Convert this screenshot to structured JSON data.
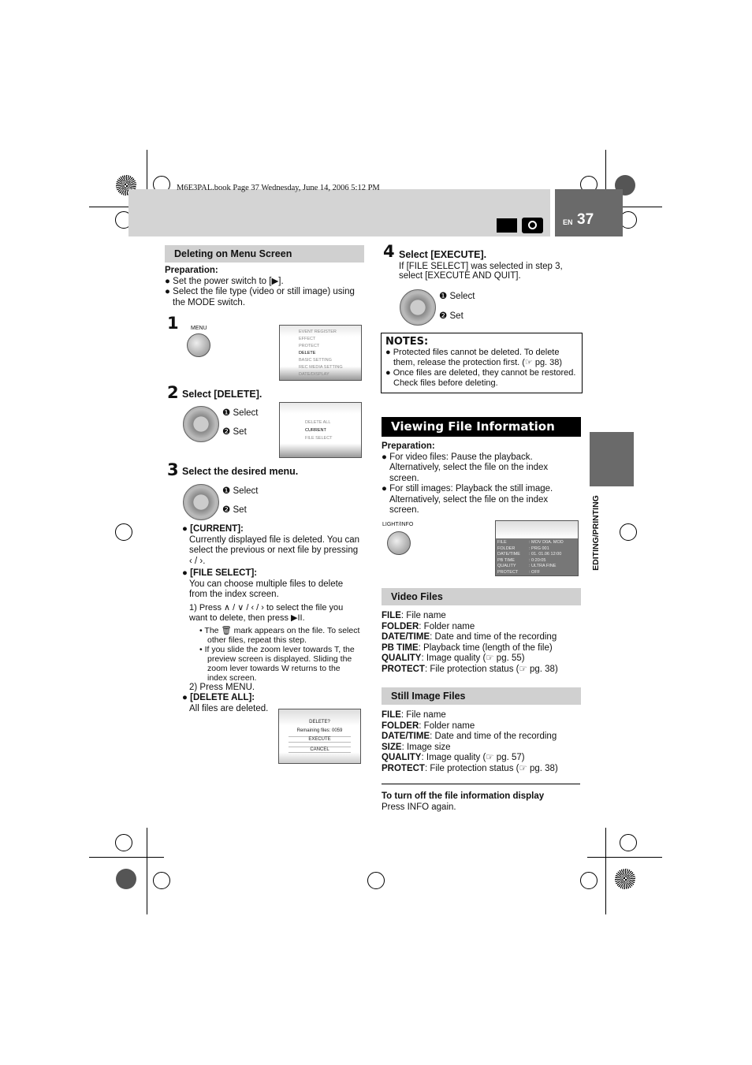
{
  "header": {
    "book_line": "M6E3PAL.book  Page 37  Wednesday, June 14, 2006  5:12 PM",
    "lang": "EN",
    "page_number": "37",
    "mode_icons": [
      "video-camera-icon",
      "still-camera-icon"
    ]
  },
  "side_tab": {
    "label": "EDITING/PRINTING"
  },
  "left": {
    "section_title": "Deleting on Menu Screen",
    "prep_label": "Preparation:",
    "prep_items": [
      "Set the power switch to [▶].",
      "Select the file type (video or still image) using the MODE switch."
    ],
    "step1": {
      "num": "1",
      "button_label": "MENU",
      "menu_items": [
        {
          "label": "EVENT REGISTER",
          "active": false
        },
        {
          "label": "EFFECT",
          "active": false
        },
        {
          "label": "PROTECT",
          "active": false
        },
        {
          "label": "DELETE",
          "active": true
        },
        {
          "label": "BASIC SETTING",
          "active": false
        },
        {
          "label": "REC MEDIA SETTING",
          "active": false
        },
        {
          "label": "DATE/DISPLAY",
          "active": false
        }
      ]
    },
    "step2": {
      "num": "2",
      "title": "Select [DELETE].",
      "select": "Select",
      "set": "Set",
      "menu_items": [
        {
          "label": "DELETE ALL",
          "active": false
        },
        {
          "label": "CURRENT",
          "active": true
        },
        {
          "label": "FILE SELECT",
          "active": false
        }
      ]
    },
    "step3": {
      "num": "3",
      "title": "Select the desired menu.",
      "select": "Select",
      "set": "Set"
    },
    "current_title": "[CURRENT]:",
    "current_text": "Currently displayed file is deleted. You can select the previous or next file by pressing ‹ / ›.",
    "fileselect_title": "[FILE SELECT]:",
    "fileselect_text": "You can choose multiple files to delete from the index screen.",
    "fs_step1": "1) Press ∧ / ∨ / ‹ / › to select the file you want to delete, then press ▶II.",
    "fs_sub1": "The 🗑 mark appears on the file. To select other files, repeat this step.",
    "fs_sub2": "If you slide the zoom lever towards T, the preview screen is displayed. Sliding the zoom lever towards W returns to the index screen.",
    "fs_step2": "2) Press MENU.",
    "deleteall_title": "[DELETE ALL]:",
    "deleteall_text": "All files are deleted.",
    "dialog": {
      "title": "DELETE?",
      "remaining": "Remaining files:   0059",
      "execute": "EXECUTE",
      "cancel": "CANCEL"
    }
  },
  "right": {
    "step4": {
      "num": "4",
      "title": "Select [EXECUTE].",
      "text": "If [FILE SELECT] was selected in step 3, select [EXECUTE AND QUIT].",
      "select": "Select",
      "set": "Set"
    },
    "notes_title": "NOTES:",
    "notes": [
      "Protected files cannot be deleted. To delete them, release the protection first. (☞ pg. 38)",
      "Once files are deleted, they cannot be restored. Check files before deleting."
    ],
    "section_title": "Viewing File Information",
    "prep_label": "Preparation:",
    "prep_items": [
      "For video files: Pause the playback. Alternatively, select the file on the index screen.",
      "For still images: Playback the still image. Alternatively, select the file on the index screen."
    ],
    "button_label": "LIGHT/INFO",
    "info_screen": [
      [
        "FILE",
        ": MOV D0A. MOD"
      ],
      [
        "FOLDER",
        ": PRG 001"
      ],
      [
        "DATE/TIME",
        ": 01. 01.06 12:00"
      ],
      [
        "PB TIME",
        ": 0:20:05"
      ],
      [
        "QUALITY",
        ": ULTRA FINE"
      ],
      [
        "PROTECT",
        ": OFF"
      ]
    ],
    "video_title": "Video Files",
    "video_items": [
      [
        "FILE",
        ": File name"
      ],
      [
        "FOLDER",
        ": Folder name"
      ],
      [
        "DATE/TIME",
        ": Date and time of the recording"
      ],
      [
        "PB TIME",
        ": Playback time (length of the file)"
      ],
      [
        "QUALITY",
        ": Image quality (☞ pg. 55)"
      ],
      [
        "PROTECT",
        ": File protection status (☞ pg. 38)"
      ]
    ],
    "still_title": "Still Image Files",
    "still_items": [
      [
        "FILE",
        ": File name"
      ],
      [
        "FOLDER",
        ": Folder name"
      ],
      [
        "DATE/TIME",
        ": Date and time of the recording"
      ],
      [
        "SIZE",
        ": Image size"
      ],
      [
        "QUALITY",
        ": Image quality (☞ pg. 57)"
      ],
      [
        "PROTECT",
        ": File protection status (☞ pg. 38)"
      ]
    ],
    "turnoff_title": "To turn off the file information display",
    "turnoff_text": "Press INFO again."
  }
}
